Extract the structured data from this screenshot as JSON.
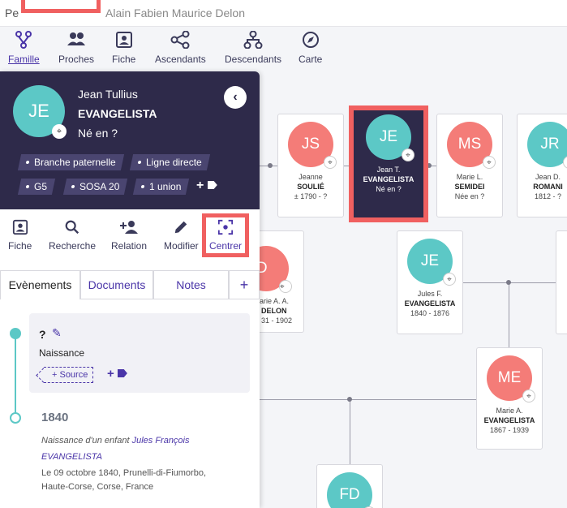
{
  "topbar": {
    "crumb": "Pe",
    "name": "Alain Fabien Maurice Delon"
  },
  "nav": [
    {
      "label": "Famille",
      "icon": "family-tree-icon"
    },
    {
      "label": "Proches",
      "icon": "people-icon"
    },
    {
      "label": "Fiche",
      "icon": "contact-card-icon"
    },
    {
      "label": "Ascendants",
      "icon": "share-nodes-icon"
    },
    {
      "label": "Descendants",
      "icon": "descendants-tree-icon"
    },
    {
      "label": "Carte",
      "icon": "compass-icon"
    }
  ],
  "tree": {
    "cards": [
      {
        "initials": "JS",
        "line1": "Jeanne",
        "line2": "SOULIÉ",
        "line3": "± 1790 - ?"
      },
      {
        "initials": "JE",
        "line1": "Jean T.",
        "line2": "EVANGELISTA",
        "line3": "Né en ?"
      },
      {
        "initials": "MS",
        "line1": "Marie L.",
        "line2": "SEMIDEI",
        "line3": "Née en ?"
      },
      {
        "initials": "JR",
        "line1": "Jean D.",
        "line2": "ROMANI",
        "line3": "1812 - ?"
      },
      {
        "initials": "MD",
        "line1": "arie A. A.",
        "line2": "DELON",
        "line3": "31 - 1902"
      },
      {
        "initials": "JE",
        "line1": "Jules F.",
        "line2": "EVANGELISTA",
        "line3": "1840 - 1876"
      },
      {
        "initials": "ME",
        "line1": "Marie A.",
        "line2": "EVANGELISTA",
        "line3": "1867 - 1939"
      },
      {
        "initials": "FD",
        "line1": "",
        "line2": "",
        "line3": ""
      }
    ]
  },
  "person": {
    "initials": "JE",
    "first_names": "Jean Tullius",
    "surname": "EVANGELISTA",
    "birth": "Né en ?",
    "tags": [
      "Branche paternelle",
      "Ligne directe",
      "G5",
      "SOSA 20",
      "1 union"
    ],
    "tag_add": "+"
  },
  "actions": [
    {
      "label": "Fiche",
      "icon": "contact-card-icon"
    },
    {
      "label": "Recherche",
      "icon": "search-icon"
    },
    {
      "label": "Relation",
      "icon": "add-person-icon"
    },
    {
      "label": "Modifier",
      "icon": "pencil-icon"
    },
    {
      "label": "Centrer",
      "icon": "center-focus-icon"
    }
  ],
  "tabs": [
    "Evènements",
    "Documents",
    "Notes",
    "+"
  ],
  "events": {
    "first": {
      "title": "?",
      "label": "Naissance",
      "source_btn": "+ Source",
      "add": "+"
    },
    "second": {
      "year": "1840",
      "desc_prefix": "Naissance d'un enfant",
      "desc_link": "Jules François EVANGELISTA",
      "place_line1": "Le 09 octobre 1840, Prunelli-di-Fiumorbo,",
      "place_line2": "Haute-Corse, Corse, France"
    }
  },
  "colors": {
    "accent": "#4a35a8",
    "panel": "#2e2a4a",
    "teal": "#5cc8c6",
    "pink": "#f47c78",
    "highlight": "#f06060"
  }
}
